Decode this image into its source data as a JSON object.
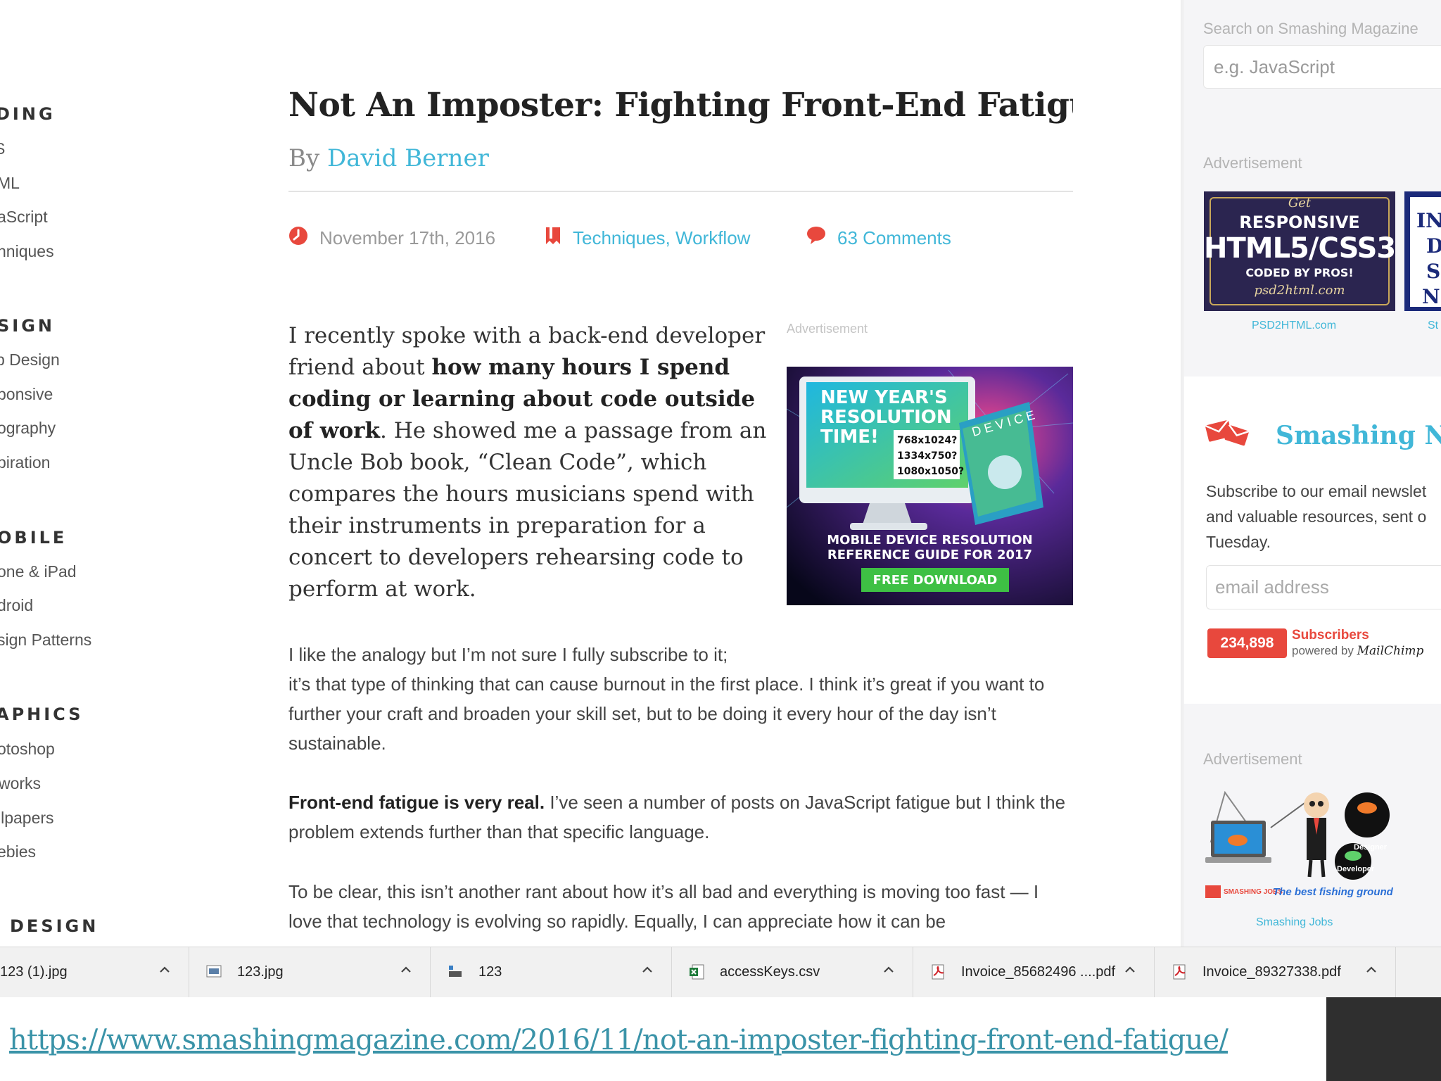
{
  "left_nav": {
    "sections": [
      {
        "heading": "DING",
        "items": [
          "S",
          "ML",
          "aScript",
          "hniques"
        ]
      },
      {
        "heading": "SIGN",
        "items": [
          "b Design",
          "ponsive",
          "ography",
          "piration"
        ]
      },
      {
        "heading": "OBILE",
        "items": [
          "one & iPad",
          "droid",
          "sign Patterns"
        ]
      },
      {
        "heading": "APHICS",
        "items": [
          "otoshop",
          "works",
          "llpapers",
          "ebies"
        ]
      },
      {
        "heading": "DESIGN",
        "items": []
      }
    ]
  },
  "article": {
    "title": "Not An Imposter: Fighting Front-End Fatigue",
    "by": "By",
    "author": "David Berner",
    "date": "November 17th, 2016",
    "categories": [
      "Techniques",
      "Workflow"
    ],
    "comments": "63 Comments",
    "lead_1": "I recently spoke with a back-end developer friend about ",
    "lead_bold": "how many hours I spend coding or learning about code outside of work",
    "lead_2": ". He showed me a passage from an Uncle Bob book, “Clean Code”, which compares the hours musicians spend with their instruments in preparation for a concert to developers rehearsing code to perform at work.",
    "ad_label": "Advertisement",
    "ad": {
      "headline_lines": [
        "NEW YEAR'S",
        "RESOLUTION",
        "TIME!"
      ],
      "resolutions": [
        "768x1024?",
        "1334x750?",
        "1080x1050?"
      ],
      "book_label": "DEVICE",
      "subline_1": "MOBILE DEVICE RESOLUTION",
      "subline_2": "REFERENCE GUIDE FOR 2017",
      "button": "FREE DOWNLOAD"
    },
    "p1_line1": "I like the analogy but I’m not sure I fully subscribe to it;",
    "p1_line2": "it’s that type of thinking that can cause burnout in the first place. I think it’s great if you want to further your craft and broaden your skill set, but to be doing it every hour of the day isn’t sustainable.",
    "p2_bold": "Front-end fatigue is very real.",
    "p2_rest": " I’ve seen a number of posts on JavaScript fatigue but I think the problem extends further than that specific language.",
    "p3": "To be clear, this isn’t another rant about how it’s all bad and everything is moving too fast — I love that technology is evolving so rapidly. Equally, I can appreciate how it can be"
  },
  "sidebar": {
    "search_label": "Search on Smashing Magazine",
    "search_placeholder": "e.g. JavaScript",
    "ad_label_1": "Advertisement",
    "ad1": {
      "line_script_top": "Get",
      "line_1": "RESPONSIVE",
      "line_2": "HTML5/CSS3",
      "line_3": "CODED BY PROS!",
      "line_script_bottom": "psd2html.com",
      "caption": "PSD2HTML.com"
    },
    "ad2_partial": {
      "lines": [
        "INI",
        "D",
        "S",
        "N"
      ],
      "caption": "St"
    },
    "newsletter_title": "Smashing Ne",
    "newsletter_desc": "Subscribe to our email newslet and valuable resources, sent o Tuesday.",
    "email_placeholder": "email address",
    "subscriber_count": "234,898",
    "subscribers_label": "Subscribers",
    "powered_by": "powered by",
    "mailchimp": "MailChimp",
    "ad_label_2": "Advertisement",
    "ad3": {
      "badge_1": "Designer",
      "badge_2": "Developer",
      "brand": "SMASHING JOBS",
      "tagline": "The best fishing ground",
      "caption": "Smashing Jobs"
    }
  },
  "downloads": [
    {
      "name": "123 (1).jpg",
      "icon": "image-file-icon"
    },
    {
      "name": "123.jpg",
      "icon": "image-file-icon"
    },
    {
      "name": "123",
      "icon": "generic-file-icon"
    },
    {
      "name": "accessKeys.csv",
      "icon": "excel-file-icon"
    },
    {
      "name": "Invoice_85682496 ....pdf",
      "icon": "pdf-file-icon"
    },
    {
      "name": "Invoice_89327338.pdf",
      "icon": "pdf-file-icon"
    }
  ],
  "footer_url": "https://www.smashingmagazine.com/2016/11/not-an-imposter-fighting-front-end-fatigue/",
  "colors": {
    "accent": "#41b7d8",
    "red": "#e8483d",
    "dark": "#2f2f2f"
  }
}
